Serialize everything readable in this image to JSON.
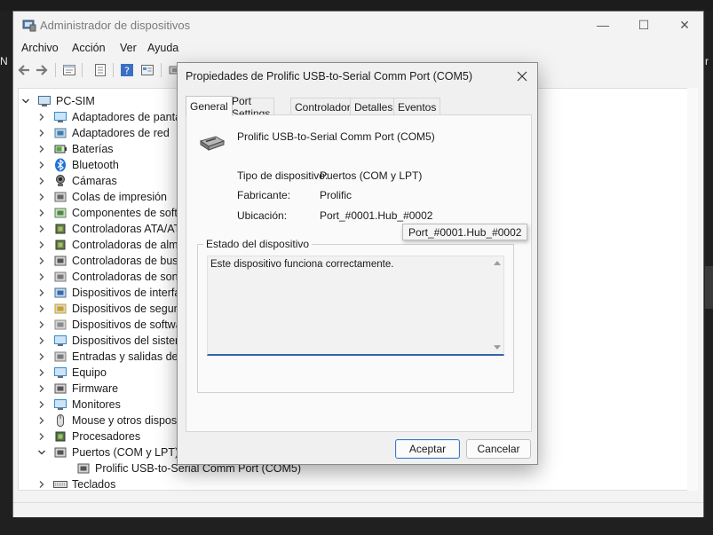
{
  "background": {
    "left_text": "N",
    "right_text": "r"
  },
  "window": {
    "title": "Administrador de dispositivos",
    "minimize_symbol": "—",
    "maximize_symbol": "☐",
    "close_symbol": "✕"
  },
  "menu": [
    "Archivo",
    "Acción",
    "Ver",
    "Ayuda"
  ],
  "toolbar": {
    "icons": [
      "back-icon",
      "forward-icon",
      "properties-icon",
      "list-icon",
      "help-icon",
      "view-icon",
      "device-icon"
    ]
  },
  "tree": {
    "root": "PC-SIM",
    "items": [
      {
        "label": "Adaptadores de pantalla",
        "icon": "display-adapter-icon"
      },
      {
        "label": "Adaptadores de red",
        "icon": "network-adapter-icon"
      },
      {
        "label": "Baterías",
        "icon": "battery-icon"
      },
      {
        "label": "Bluetooth",
        "icon": "bluetooth-icon"
      },
      {
        "label": "Cámaras",
        "icon": "camera-icon"
      },
      {
        "label": "Colas de impresión",
        "icon": "print-queue-icon"
      },
      {
        "label": "Componentes de software",
        "icon": "software-component-icon"
      },
      {
        "label": "Controladoras ATA/ATAPI IDE",
        "icon": "ide-controller-icon"
      },
      {
        "label": "Controladoras de almacenamiento",
        "icon": "storage-controller-icon"
      },
      {
        "label": "Controladoras de bus serie universal",
        "icon": "usb-controller-icon"
      },
      {
        "label": "Controladoras de sonido y vídeo y dispositivos de juego",
        "icon": "sound-controller-icon"
      },
      {
        "label": "Dispositivos de interfaz de usuario (HID)",
        "icon": "hid-icon"
      },
      {
        "label": "Dispositivos de seguridad",
        "icon": "security-device-icon"
      },
      {
        "label": "Dispositivos de software",
        "icon": "software-device-icon"
      },
      {
        "label": "Dispositivos del sistema",
        "icon": "system-device-icon"
      },
      {
        "label": "Entradas y salidas de audio",
        "icon": "audio-io-icon"
      },
      {
        "label": "Equipo",
        "icon": "computer-icon"
      },
      {
        "label": "Firmware",
        "icon": "firmware-icon"
      },
      {
        "label": "Monitores",
        "icon": "monitor-icon"
      },
      {
        "label": "Mouse y otros dispositivos señaladores",
        "icon": "mouse-icon"
      },
      {
        "label": "Procesadores",
        "icon": "processor-icon"
      },
      {
        "label": "Puertos (COM y LPT)",
        "icon": "port-icon",
        "expanded": true
      },
      {
        "label": "Prolific USB-to-Serial Comm Port (COM5)",
        "icon": "serial-port-icon",
        "child": true
      },
      {
        "label": "Teclados",
        "icon": "keyboard-icon"
      }
    ]
  },
  "dialog": {
    "title": "Propiedades de Prolific USB-to-Serial Comm Port (COM5)",
    "tabs": [
      "General",
      "Port Settings",
      "Controlador",
      "Detalles",
      "Eventos"
    ],
    "device_name": "Prolific USB-to-Serial Comm Port (COM5)",
    "type_label": "Tipo de dispositivo:",
    "type_value": "Puertos (COM y LPT)",
    "manufacturer_label": "Fabricante:",
    "manufacturer_value": "Prolific",
    "location_label": "Ubicación:",
    "location_value": "Port_#0001.Hub_#0002",
    "tooltip": "Port_#0001.Hub_#0002",
    "status_group": "Estado del dispositivo",
    "status_text": "Este dispositivo funciona correctamente.",
    "ok": "Aceptar",
    "cancel": "Cancelar"
  },
  "colors": {
    "accent": "#3366a8",
    "window_bg": "#f3f3f3",
    "dialog_bg": "#f0f0f0"
  }
}
